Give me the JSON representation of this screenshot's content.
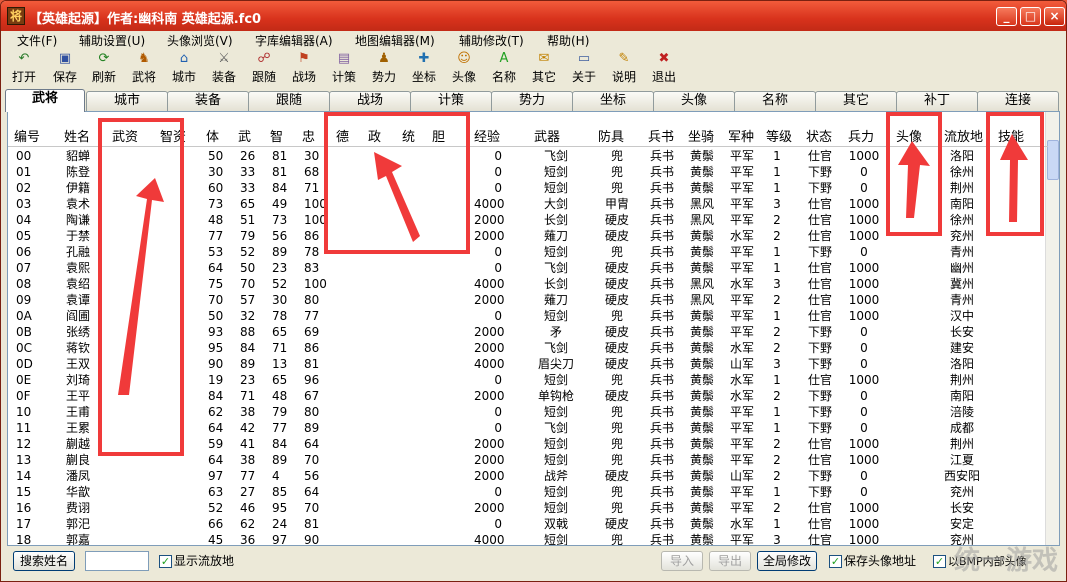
{
  "title": "【英雄起源】作者:幽科南    英雄起源.fc0",
  "window_buttons": {
    "min": "_",
    "max": "□",
    "close": "×"
  },
  "menu": [
    "文件(F)",
    "辅助设置(U)",
    "头像浏览(V)",
    "字库编辑器(A)",
    "地图编辑器(M)",
    "辅助修改(T)",
    "帮助(H)"
  ],
  "toolbar": [
    {
      "label": "打开",
      "icon": "open-icon"
    },
    {
      "label": "保存",
      "icon": "save-icon"
    },
    {
      "label": "刷新",
      "icon": "refresh-icon"
    },
    {
      "label": "武将",
      "icon": "general-icon"
    },
    {
      "label": "城市",
      "icon": "city-icon"
    },
    {
      "label": "装备",
      "icon": "equipment-icon"
    },
    {
      "label": "跟随",
      "icon": "follow-icon"
    },
    {
      "label": "战场",
      "icon": "battlefield-icon"
    },
    {
      "label": "计策",
      "icon": "strategy-icon"
    },
    {
      "label": "势力",
      "icon": "faction-icon"
    },
    {
      "label": "坐标",
      "icon": "coordinate-icon"
    },
    {
      "label": "头像",
      "icon": "portrait-icon"
    },
    {
      "label": "名称",
      "icon": "name-icon"
    },
    {
      "label": "其它",
      "icon": "other-icon"
    },
    {
      "label": "关于",
      "icon": "about-icon"
    },
    {
      "label": "说明",
      "icon": "help-icon"
    },
    {
      "label": "退出",
      "icon": "exit-icon"
    }
  ],
  "tabs": [
    "武将",
    "城市",
    "装备",
    "跟随",
    "战场",
    "计策",
    "势力",
    "坐标",
    "头像",
    "名称",
    "其它",
    "补丁",
    "连接"
  ],
  "active_tab": "武将",
  "columns": [
    "编号",
    "姓名",
    "武资",
    "智资",
    "体",
    "武",
    "智",
    "忠",
    "德",
    "政",
    "统",
    "胆",
    "经验",
    "武器",
    "防具",
    "兵书",
    "坐骑",
    "军种",
    "等级",
    "状态",
    "兵力",
    "头像",
    "流放地",
    "技能"
  ],
  "rows": [
    [
      "00",
      "貂蝉",
      "",
      "",
      "50",
      "26",
      "81",
      "30",
      "",
      "",
      "",
      "",
      "0",
      "飞剑",
      "兜",
      "兵书",
      "黄鬃",
      "平军",
      "1",
      "仕官",
      "1000",
      "",
      "洛阳",
      ""
    ],
    [
      "01",
      "陈登",
      "",
      "",
      "30",
      "33",
      "81",
      "68",
      "",
      "",
      "",
      "",
      "0",
      "短剑",
      "兜",
      "兵书",
      "黄鬃",
      "平军",
      "1",
      "下野",
      "0",
      "",
      "徐州",
      ""
    ],
    [
      "02",
      "伊籍",
      "",
      "",
      "60",
      "33",
      "84",
      "71",
      "",
      "",
      "",
      "",
      "0",
      "短剑",
      "兜",
      "兵书",
      "黄鬃",
      "平军",
      "1",
      "下野",
      "0",
      "",
      "荆州",
      ""
    ],
    [
      "03",
      "袁术",
      "",
      "",
      "73",
      "65",
      "49",
      "100",
      "",
      "",
      "",
      "",
      "4000",
      "大剑",
      "甲胄",
      "兵书",
      "黑风",
      "平军",
      "3",
      "仕官",
      "1000",
      "",
      "南阳",
      ""
    ],
    [
      "04",
      "陶谦",
      "",
      "",
      "48",
      "51",
      "73",
      "100",
      "",
      "",
      "",
      "",
      "2000",
      "长剑",
      "硬皮",
      "兵书",
      "黑风",
      "平军",
      "2",
      "仕官",
      "1000",
      "",
      "徐州",
      ""
    ],
    [
      "05",
      "于禁",
      "",
      "",
      "77",
      "79",
      "56",
      "86",
      "",
      "",
      "",
      "",
      "2000",
      "薙刀",
      "硬皮",
      "兵书",
      "黄鬃",
      "水军",
      "2",
      "仕官",
      "1000",
      "",
      "兖州",
      ""
    ],
    [
      "06",
      "孔融",
      "",
      "",
      "53",
      "52",
      "89",
      "78",
      "",
      "",
      "",
      "",
      "0",
      "短剑",
      "兜",
      "兵书",
      "黄鬃",
      "平军",
      "1",
      "下野",
      "0",
      "",
      "青州",
      ""
    ],
    [
      "07",
      "袁熙",
      "",
      "",
      "64",
      "50",
      "23",
      "83",
      "",
      "",
      "",
      "",
      "0",
      "飞剑",
      "硬皮",
      "兵书",
      "黄鬃",
      "平军",
      "1",
      "仕官",
      "1000",
      "",
      "幽州",
      ""
    ],
    [
      "08",
      "袁绍",
      "",
      "",
      "75",
      "70",
      "52",
      "100",
      "",
      "",
      "",
      "",
      "4000",
      "长剑",
      "硬皮",
      "兵书",
      "黑风",
      "水军",
      "3",
      "仕官",
      "1000",
      "",
      "冀州",
      ""
    ],
    [
      "09",
      "袁谭",
      "",
      "",
      "70",
      "57",
      "30",
      "80",
      "",
      "",
      "",
      "",
      "2000",
      "薙刀",
      "硬皮",
      "兵书",
      "黑风",
      "平军",
      "2",
      "仕官",
      "1000",
      "",
      "青州",
      ""
    ],
    [
      "0A",
      "阎圃",
      "",
      "",
      "50",
      "32",
      "78",
      "77",
      "",
      "",
      "",
      "",
      "0",
      "短剑",
      "兜",
      "兵书",
      "黄鬃",
      "平军",
      "1",
      "仕官",
      "1000",
      "",
      "汉中",
      ""
    ],
    [
      "0B",
      "张绣",
      "",
      "",
      "93",
      "88",
      "65",
      "69",
      "",
      "",
      "",
      "",
      "2000",
      "矛",
      "硬皮",
      "兵书",
      "黄鬃",
      "平军",
      "2",
      "下野",
      "0",
      "",
      "长安",
      ""
    ],
    [
      "0C",
      "蒋钦",
      "",
      "",
      "95",
      "84",
      "71",
      "86",
      "",
      "",
      "",
      "",
      "2000",
      "飞剑",
      "硬皮",
      "兵书",
      "黄鬃",
      "水军",
      "2",
      "下野",
      "0",
      "",
      "建安",
      ""
    ],
    [
      "0D",
      "王双",
      "",
      "",
      "90",
      "89",
      "13",
      "81",
      "",
      "",
      "",
      "",
      "4000",
      "眉尖刀",
      "硬皮",
      "兵书",
      "黄鬃",
      "山军",
      "3",
      "下野",
      "0",
      "",
      "洛阳",
      ""
    ],
    [
      "0E",
      "刘琦",
      "",
      "",
      "19",
      "23",
      "65",
      "96",
      "",
      "",
      "",
      "",
      "0",
      "短剑",
      "兜",
      "兵书",
      "黄鬃",
      "水军",
      "1",
      "仕官",
      "1000",
      "",
      "荆州",
      ""
    ],
    [
      "0F",
      "王平",
      "",
      "",
      "84",
      "71",
      "48",
      "67",
      "",
      "",
      "",
      "",
      "2000",
      "单钩枪",
      "硬皮",
      "兵书",
      "黄鬃",
      "水军",
      "2",
      "下野",
      "0",
      "",
      "南阳",
      ""
    ],
    [
      "10",
      "王甫",
      "",
      "",
      "62",
      "38",
      "79",
      "80",
      "",
      "",
      "",
      "",
      "0",
      "短剑",
      "兜",
      "兵书",
      "黄鬃",
      "平军",
      "1",
      "下野",
      "0",
      "",
      "涪陵",
      ""
    ],
    [
      "11",
      "王累",
      "",
      "",
      "64",
      "42",
      "77",
      "89",
      "",
      "",
      "",
      "",
      "0",
      "飞剑",
      "兜",
      "兵书",
      "黄鬃",
      "平军",
      "1",
      "下野",
      "0",
      "",
      "成都",
      ""
    ],
    [
      "12",
      "蒯越",
      "",
      "",
      "59",
      "41",
      "84",
      "64",
      "",
      "",
      "",
      "",
      "2000",
      "短剑",
      "兜",
      "兵书",
      "黄鬃",
      "平军",
      "2",
      "仕官",
      "1000",
      "",
      "荆州",
      ""
    ],
    [
      "13",
      "蒯良",
      "",
      "",
      "64",
      "38",
      "89",
      "70",
      "",
      "",
      "",
      "",
      "2000",
      "短剑",
      "兜",
      "兵书",
      "黄鬃",
      "平军",
      "2",
      "仕官",
      "1000",
      "",
      "江夏",
      ""
    ],
    [
      "14",
      "潘凤",
      "",
      "",
      "97",
      "77",
      "4",
      "56",
      "",
      "",
      "",
      "",
      "2000",
      "战斧",
      "硬皮",
      "兵书",
      "黄鬃",
      "山军",
      "2",
      "下野",
      "0",
      "",
      "西安阳",
      ""
    ],
    [
      "15",
      "华歆",
      "",
      "",
      "63",
      "27",
      "85",
      "64",
      "",
      "",
      "",
      "",
      "0",
      "短剑",
      "兜",
      "兵书",
      "黄鬃",
      "平军",
      "1",
      "下野",
      "0",
      "",
      "兖州",
      ""
    ],
    [
      "16",
      "费诩",
      "",
      "",
      "52",
      "46",
      "95",
      "70",
      "",
      "",
      "",
      "",
      "2000",
      "短剑",
      "兜",
      "兵书",
      "黄鬃",
      "平军",
      "2",
      "仕官",
      "1000",
      "",
      "长安",
      ""
    ],
    [
      "17",
      "郭汜",
      "",
      "",
      "66",
      "62",
      "24",
      "81",
      "",
      "",
      "",
      "",
      "0",
      "双戟",
      "硬皮",
      "兵书",
      "黄鬃",
      "水军",
      "1",
      "仕官",
      "1000",
      "",
      "安定",
      ""
    ],
    [
      "18",
      "郭嘉",
      "",
      "",
      "45",
      "36",
      "97",
      "90",
      "",
      "",
      "",
      "",
      "4000",
      "短剑",
      "兜",
      "兵书",
      "黄鬃",
      "平军",
      "3",
      "仕官",
      "1000",
      "",
      "兖州",
      ""
    ]
  ],
  "bottom": {
    "search_button": "搜索姓名",
    "search_value": "",
    "show_exile_label": "显示流放地",
    "import_button": "导入",
    "export_button": "导出",
    "global_edit_button": "全局修改",
    "save_portrait_label": "保存头像地址",
    "bmp_label": "以BMP内部头像"
  },
  "watermark": "统一游戏"
}
